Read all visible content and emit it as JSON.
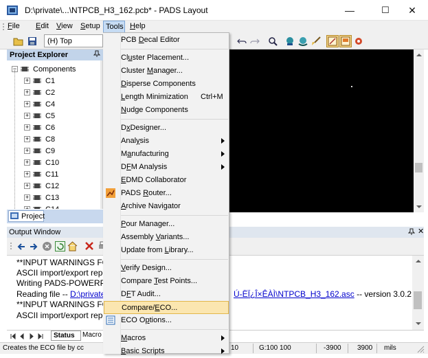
{
  "window": {
    "title": "D:\\private\\...\\NTPCB_H3_162.pcb* - PADS Layout",
    "minimize": "—",
    "maximize": "☐",
    "close": "✕"
  },
  "menubar": [
    {
      "pre": "",
      "u": "F",
      "post": "ile"
    },
    {
      "pre": "",
      "u": "E",
      "post": "dit"
    },
    {
      "pre": "",
      "u": "V",
      "post": "iew"
    },
    {
      "pre": "",
      "u": "S",
      "post": "etup"
    },
    {
      "pre": "",
      "u": "T",
      "post": "ools"
    },
    {
      "pre": "",
      "u": "H",
      "post": "elp"
    }
  ],
  "toolbar": {
    "layer_value": "(H) Top"
  },
  "project_explorer": {
    "title": "Project Explorer",
    "pin": "p",
    "root": "Components",
    "items": [
      "C1",
      "C2",
      "C4",
      "C5",
      "C6",
      "C8",
      "C9",
      "C10",
      "C11",
      "C12",
      "C13",
      "C14"
    ],
    "tab": "Project"
  },
  "tools_menu": [
    {
      "label": "PCB Decal Editor",
      "u": "D"
    },
    {
      "sep": true
    },
    {
      "label": "Cluster Placement...",
      "u": "u"
    },
    {
      "label": "Cluster Manager...",
      "u": "M"
    },
    {
      "label": "Disperse Components",
      "u": "D"
    },
    {
      "label": "Length Minimization",
      "shortcut": "Ctrl+M",
      "u": "L"
    },
    {
      "label": "Nudge Components",
      "u": "N"
    },
    {
      "sep": true
    },
    {
      "label": "DxDesigner...",
      "u": "x"
    },
    {
      "label": "Analysis",
      "submenu": true,
      "u": "y"
    },
    {
      "label": "Manufacturing",
      "submenu": true,
      "u": "a"
    },
    {
      "label": "DFM Analysis",
      "submenu": true,
      "u": "F"
    },
    {
      "label": "EDMD Collaborator",
      "u": "E"
    },
    {
      "label": "PADS Router...",
      "u": "R",
      "icon": true
    },
    {
      "label": "Archive Navigator",
      "u": "A"
    },
    {
      "sep": true
    },
    {
      "label": "Pour Manager...",
      "u": "P"
    },
    {
      "label": "Assembly Variants...",
      "u": "V"
    },
    {
      "label": "Update from Library...",
      "u": "L"
    },
    {
      "sep": true
    },
    {
      "label": "Verify Design...",
      "u": "V"
    },
    {
      "label": "Compare Test Points...",
      "u": "T"
    },
    {
      "label": "DFT Audit...",
      "u": "F"
    },
    {
      "label": "Compare/ECO...",
      "u": "E",
      "highlight": true
    },
    {
      "label": "ECO Options...",
      "u": "p",
      "icon": true
    },
    {
      "sep": true
    },
    {
      "label": "Macros",
      "submenu": true,
      "u": "M"
    },
    {
      "label": "Basic Scripts",
      "submenu": true,
      "u": "B"
    }
  ],
  "output": {
    "title": "Output Window",
    "lines": [
      "**INPUT WARNINGS FOU",
      "ASCII import/export repor",
      "Writing PADS-POWERPC",
      "Reading file -- ",
      "**INPUT WARNINGS FOU",
      "ASCII import/export repor"
    ],
    "link": "D:\\private\\a",
    "link_tail": "Ú-ËÏ¿Î×ÊÀÌ\\NTPCB_H3_162.asc",
    "version": " -- version 3.0.2",
    "tabs": [
      "Status",
      "Macro"
    ]
  },
  "status": {
    "message": "Creates the ECO file by cc",
    "g": "10",
    "grid": "G:100 100",
    "x": "-3900",
    "y": "3900",
    "units": "mils"
  }
}
